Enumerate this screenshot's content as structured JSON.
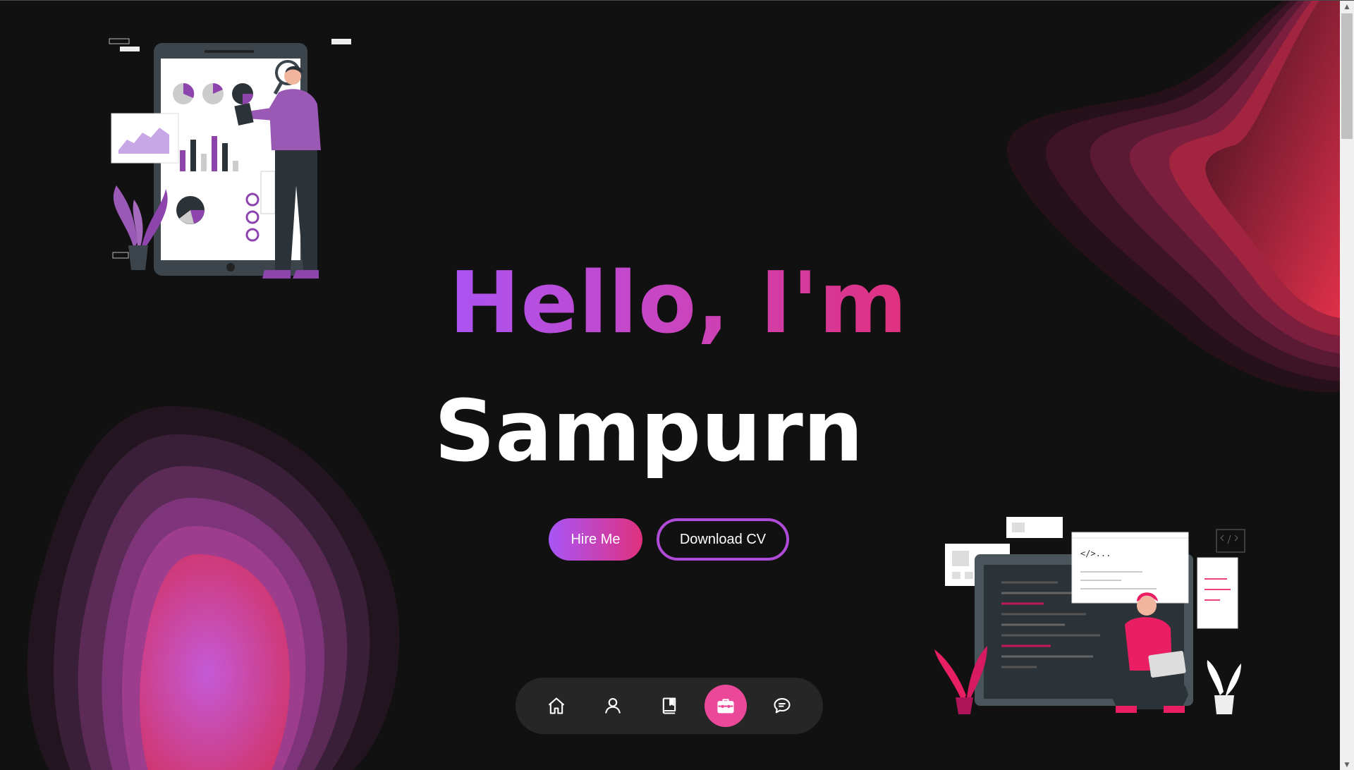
{
  "hero": {
    "greeting": "Hello, I'm",
    "name": "Sampurn"
  },
  "buttons": {
    "hire_label": "Hire Me",
    "cv_label": "Download CV"
  },
  "nav": {
    "items": [
      {
        "icon": "home-icon",
        "active": false
      },
      {
        "icon": "user-icon",
        "active": false
      },
      {
        "icon": "book-icon",
        "active": false
      },
      {
        "icon": "briefcase-icon",
        "active": true
      },
      {
        "icon": "chat-icon",
        "active": false
      }
    ]
  },
  "illustrations": {
    "analyst_code_tag": "</>..."
  },
  "colors": {
    "background": "#111111",
    "accent_purple": "#a855f7",
    "accent_pink": "#ec4899",
    "accent_red": "#e0307e",
    "dock": "#262626"
  }
}
